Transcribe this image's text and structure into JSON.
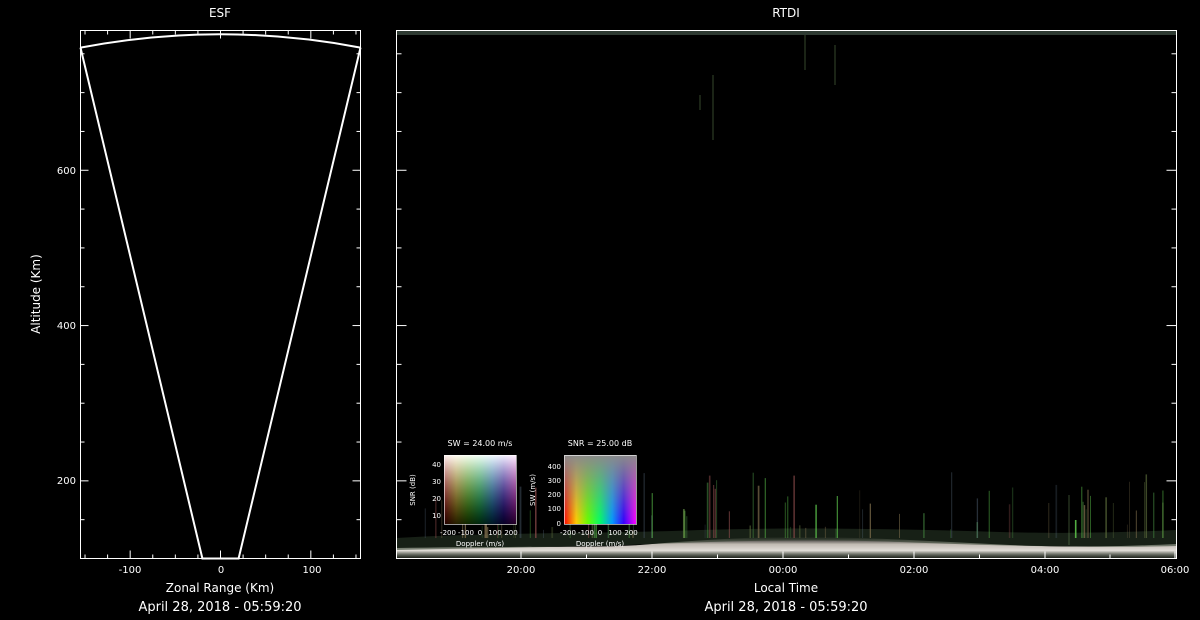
{
  "esf": {
    "title": "ESF",
    "xlabel": "Zonal Range (Km)",
    "ylabel": "Altitude (Km)",
    "footer": "April 28, 2018 - 05:59:20",
    "x_ticks": [
      "-100",
      "0",
      "100"
    ],
    "y_ticks": [
      "200",
      "400",
      "600"
    ]
  },
  "rtdi": {
    "title": "RTDI",
    "xlabel": "Local Time",
    "footer": "April 28, 2018 - 05:59:20",
    "x_ticks": [
      "20:00",
      "22:00",
      "00:00",
      "02:00",
      "04:00",
      "06:00"
    ]
  },
  "legend_sw": {
    "title": "SW = 24.00 m/s",
    "ylabel": "SNR (dB)",
    "xlabel": "Doppler (m/s)",
    "y_ticks": [
      "40",
      "30",
      "20",
      "10"
    ],
    "x_ticks": [
      "-200",
      "-100",
      "0",
      "100",
      "200"
    ]
  },
  "legend_snr": {
    "title": "SNR = 25.00 dB",
    "ylabel": "SW (m/s)",
    "xlabel": "Doppler (m/s)",
    "y_ticks": [
      "400",
      "300",
      "200",
      "100",
      "0"
    ],
    "x_ticks": [
      "-200",
      "-100",
      "0",
      "100",
      "200"
    ]
  },
  "colors": {
    "background": "#000000",
    "axes": "#ffffff",
    "echo_band": "#d6cfc6",
    "echo_dark": "#2a3a28",
    "echo_green": "#5bbf4a"
  },
  "chart_data": [
    {
      "type": "line",
      "title": "ESF",
      "xlabel": "Zonal Range (Km)",
      "ylabel": "Altitude (Km)",
      "xlim": [
        -155,
        155
      ],
      "ylim": [
        100,
        780
      ],
      "series": [
        {
          "values": [
            [
              -155,
              758
            ],
            [
              -20,
              100
            ],
            [
              20,
              100
            ],
            [
              155,
              758
            ]
          ]
        }
      ],
      "arc": {
        "shape": "top arc",
        "x": [
          -155,
          0,
          155
        ],
        "y": [
          758,
          782,
          758
        ]
      }
    },
    {
      "type": "heatmap",
      "title": "RTDI",
      "xlabel": "Local Time",
      "ylabel": "",
      "xlim": [
        "18:05",
        "06:00"
      ],
      "ylim": [
        100,
        780
      ],
      "x_ticks": [
        "20:00",
        "22:00",
        "00:00",
        "02:00",
        "04:00",
        "06:00"
      ],
      "description_band": "bright echo layer near 100-130 km across the whole night, with scattered plume streaks up to ~200 km"
    }
  ]
}
